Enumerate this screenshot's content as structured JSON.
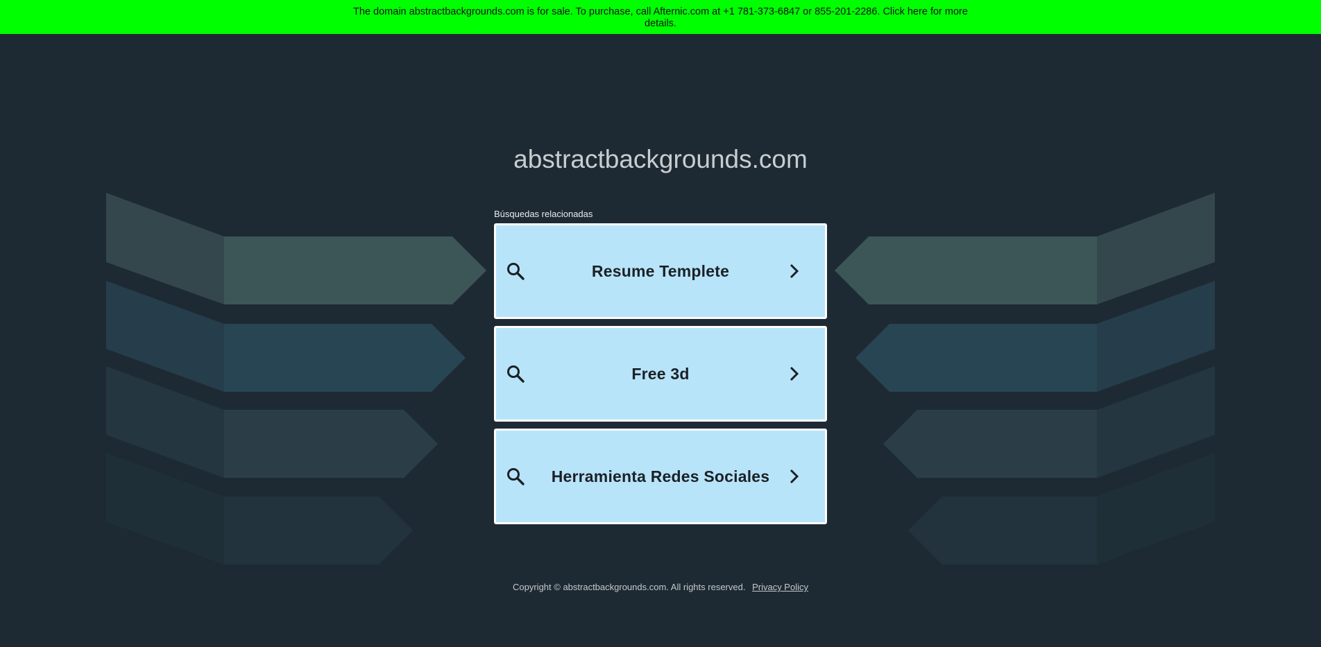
{
  "banner": {
    "text": "The domain abstractbackgrounds.com is for sale. To purchase, call Afternic.com at +1 781-373-6847 or 855-201-2286. Click here for more details."
  },
  "header": {
    "domain": "abstractbackgrounds.com"
  },
  "related": {
    "label": "Búsquedas relacionadas",
    "items": [
      {
        "label": "Resume Templete"
      },
      {
        "label": "Free 3d"
      },
      {
        "label": "Herramienta Redes Sociales"
      }
    ]
  },
  "footer": {
    "copyright": "Copyright © abstractbackgrounds.com.  All rights reserved.",
    "privacy_label": "Privacy Policy"
  },
  "icons": {
    "search": "search-icon",
    "chevron": "chevron-right-icon"
  },
  "colors": {
    "banner": "#00ff00",
    "background": "#1e2a33",
    "card": "#b8e4fa"
  }
}
